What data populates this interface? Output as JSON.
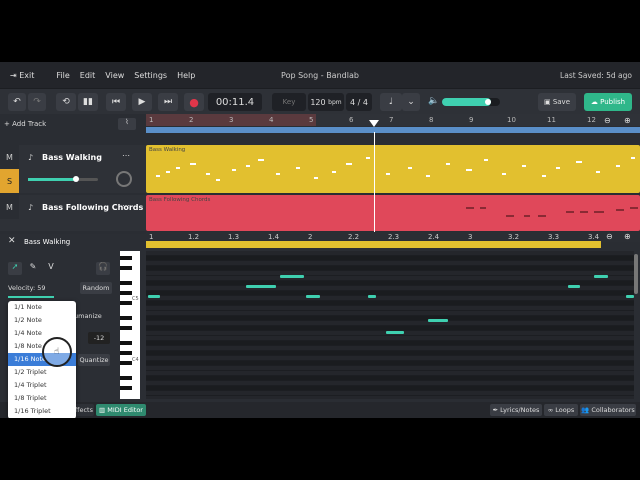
{
  "menu": {
    "exit": "Exit",
    "file": "File",
    "edit": "Edit",
    "view": "View",
    "settings": "Settings",
    "help": "Help",
    "title": "Pop Song - Bandlab",
    "saved": "Last Saved: 5d ago"
  },
  "transport": {
    "time": "00:11.4",
    "key": "Key",
    "bpm": "120",
    "bpm_unit": "bpm",
    "sig": "4 / 4",
    "save": "Save",
    "publish": "Publish",
    "volume_level": 0.85
  },
  "ruler": {
    "add_track": "Add Track",
    "bars": [
      "1",
      "2",
      "3",
      "4",
      "5",
      "6",
      "7",
      "8",
      "9",
      "10",
      "11",
      "12"
    ]
  },
  "tracks": [
    {
      "m": "M",
      "s": "S",
      "name": "Bass Walking",
      "clip": "Bass Walking",
      "color": "#e2c02f"
    },
    {
      "m": "M",
      "name": "Bass Following Chords",
      "clip": "Bass Following Chords",
      "color": "#e0485a"
    }
  ],
  "editor": {
    "close": "✕",
    "title": "Bass Walking",
    "velocity": "Velocity: 59",
    "random": "Random",
    "humanize": "umanize",
    "shift": "-12",
    "quantize": "Quantize",
    "v": "V",
    "ruler": [
      "1",
      "1.2",
      "1.3",
      "1.4",
      "2",
      "2.2",
      "2.3",
      "2.4",
      "3",
      "3.2",
      "3.3",
      "3.4"
    ],
    "key_c5": "C5",
    "key_c4": "C4"
  },
  "quantize_options": [
    "1/1 Note",
    "1/2 Note",
    "1/4 Note",
    "1/8 Note",
    "1/16 Note",
    "1/2 Triplet",
    "1/4 Triplet",
    "1/8 Triplet",
    "1/16 Triplet"
  ],
  "quantize_selected": "1/16 Note",
  "bottom": {
    "effects": "ffects",
    "midi": "MIDI Editor",
    "lyrics": "Lyrics/Notes",
    "loops": "Loops",
    "collab": "Collaborators"
  },
  "colors": {
    "accent": "#3fd0b0",
    "yellow": "#e2c02f",
    "red": "#e0485a",
    "publish": "#2fb78a"
  }
}
